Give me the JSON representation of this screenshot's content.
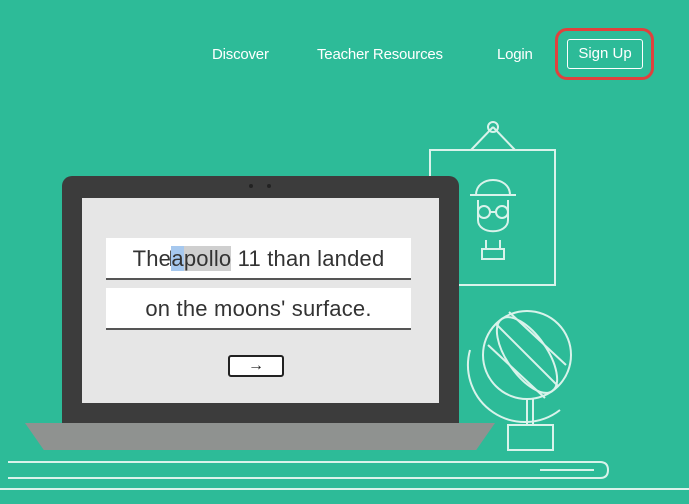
{
  "nav": {
    "discover": "Discover",
    "teacher_resources": "Teacher Resources",
    "login": "Login",
    "signup": "Sign Up"
  },
  "editor": {
    "line1_before": "The",
    "line1_selected_char": "a",
    "line1_selected_rest": "pollo",
    "line1_after": " 11 than landed",
    "line2": "on the moons' surface.",
    "next_button": "→"
  },
  "colors": {
    "background": "#2dbb98",
    "highlight": "#e0413d",
    "laptop": "#3c3c3c"
  },
  "icons": [
    "portrait-frame-icon",
    "globe-icon",
    "text-cursor-icon",
    "arrow-right-icon"
  ]
}
